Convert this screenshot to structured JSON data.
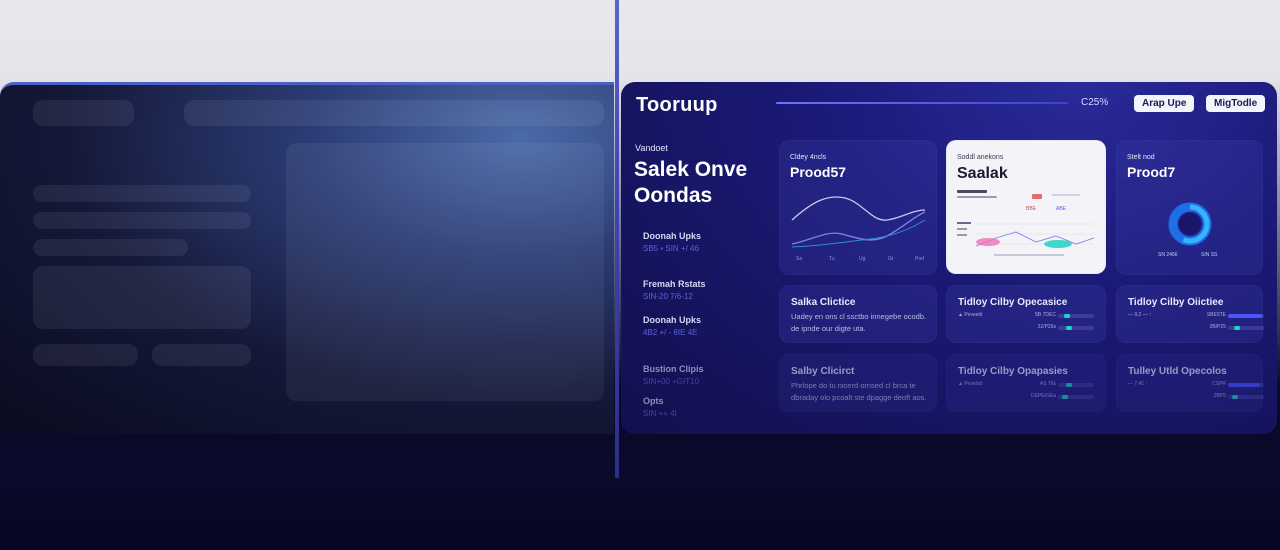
{
  "app": {
    "title": "Tooruup",
    "progress_text": "C25%",
    "buttons": {
      "primary": "Arap Upe",
      "secondary": "MigTodle"
    }
  },
  "sidebar": {
    "kicker": "Vandoet",
    "heading": "Salek Onve Oondas",
    "items": [
      {
        "title": "Doonah Upks",
        "sub": "SB5 • SIN +/ 46"
      },
      {
        "title": "Fremah Rstats",
        "sub": "SIN-20 7/6-12"
      },
      {
        "title": "Doonah Upks",
        "sub": "4B2 +/ - 6IE 4E"
      },
      {
        "title": "Bustion Clipis",
        "sub": "SIN+00 +GIT10"
      },
      {
        "title": "Opts",
        "sub": "SIN ++ 4I"
      }
    ]
  },
  "cards": {
    "line_chart": {
      "kicker": "Cldey 4ncls",
      "title": "Prood57",
      "ticks": [
        "Sa",
        "Tu",
        "Ug",
        "Gt",
        "Pod"
      ]
    },
    "highlight": {
      "kicker": "Soddl anekons",
      "title": "Saalak",
      "badge_1": "BBE",
      "badge_2": "ABE"
    },
    "donut": {
      "kicker": "Stelt nod",
      "title": "Prood7",
      "label_left": "SN 2466",
      "label_right": "SIN SS"
    },
    "sales_1": {
      "title": "Salka Clictice",
      "body": "Uadey en ons cl ssctbo innegebe ocodb. de ipnde our digte uta."
    },
    "sales_2": {
      "title": "Salby Clicirct",
      "body": "Phrlope do tu nicerd ornsed cl brca te dbraday olo pcoalt ste dpagge deoft aos."
    },
    "mid_1": {
      "title": "Tidloy Cilby Opecasice",
      "rows": [
        {
          "a": "▲ Peveeld",
          "b": "SB 7DEC",
          "level": 0.3
        },
        {
          "a": "",
          "b": "22/P26s",
          "level": 0.35
        }
      ]
    },
    "mid_2": {
      "title": "Tidloy Cilby Opapasies",
      "rows": [
        {
          "a": "▲ Pevelsd",
          "b": "AS 76s",
          "level": 0.35
        },
        {
          "a": "",
          "b": "DEPE/GEa",
          "level": 0.2
        }
      ]
    },
    "right_1": {
      "title": "Tidloy Cilby Oiictiee",
      "rows": [
        {
          "a": "— 9.2 — ↑",
          "b": "SBE5TE",
          "level": 0.95
        },
        {
          "a": "",
          "b": "2B/P25",
          "level": 0.35
        }
      ]
    },
    "right_2": {
      "title": "Tulley Utld Opecolos",
      "rows": [
        {
          "a": "— 7.41 ↑",
          "b": "CSPR",
          "level": 0.9
        },
        {
          "a": "",
          "b": "ZBP5",
          "level": 0.3
        }
      ]
    }
  },
  "colors": {
    "accent": "#4b55ff",
    "teal": "#1fd2c8",
    "pink": "#f06ab4",
    "dashboard_bg": "#15145e"
  }
}
